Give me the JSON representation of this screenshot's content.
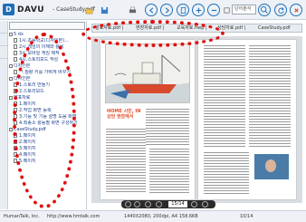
{
  "app": {
    "name": "DAVU",
    "document_title": "CaseStudy.pdf"
  },
  "toolbar": {
    "search_placeholder": "단어분석",
    "buttons": [
      {
        "name": "open-button",
        "icon": "folder-icon"
      },
      {
        "name": "save-button",
        "icon": "save-icon"
      },
      {
        "name": "print-button",
        "icon": "printer-icon"
      },
      {
        "name": "prev-view-button",
        "icon": "left-arrow-icon"
      },
      {
        "name": "next-view-button",
        "icon": "right-arrow-icon"
      },
      {
        "name": "page-view-button",
        "icon": "page-icon"
      },
      {
        "name": "zoom-in-button",
        "icon": "zoom-in-icon"
      },
      {
        "name": "zoom-out-button",
        "icon": "zoom-out-icon"
      },
      {
        "name": "fit-button",
        "icon": "fit-icon"
      },
      {
        "name": "search-button",
        "icon": "search-icon"
      },
      {
        "name": "refresh-button",
        "icon": "refresh-icon"
      },
      {
        "name": "close-button",
        "icon": "close-icon"
      }
    ]
  },
  "sidebar": {
    "tree": [
      {
        "label": "5 dx",
        "depth": 0,
        "kind": "folder"
      },
      {
        "label": "1시.초등학교(디자인본)...",
        "depth": 1,
        "kind": "file"
      },
      {
        "label": "2시.게임의 이해와 활용",
        "depth": 1,
        "kind": "file"
      },
      {
        "label": "3시.모바일 게임 제작",
        "depth": 1,
        "kind": "file"
      },
      {
        "label": "4시.스토리보드 작성",
        "depth": 1,
        "kind": "file"
      },
      {
        "label": "디자인본",
        "depth": 0,
        "kind": "folder"
      },
      {
        "label": "ㄱ.질량 키를 가벼게 바꾸기",
        "depth": 1,
        "kind": "file"
      },
      {
        "label": "디자인본",
        "depth": 0,
        "kind": "folder"
      },
      {
        "label": "1.스토리 만들기",
        "depth": 1,
        "kind": "file"
      },
      {
        "label": "2.스토리보드",
        "depth": 1,
        "kind": "file"
      },
      {
        "label": "발표자료",
        "depth": 0,
        "kind": "folder"
      },
      {
        "label": "1.페이지",
        "depth": 1,
        "kind": "file"
      },
      {
        "label": "2.작업 화면 등록",
        "depth": 1,
        "kind": "file"
      },
      {
        "label": "3.기능 및 기능 설명 도움 화면",
        "depth": 1,
        "kind": "file"
      },
      {
        "label": "4.최종소 활동별 화면 구성하기",
        "depth": 1,
        "kind": "file"
      },
      {
        "label": "CaseStudy.pdf",
        "depth": 0,
        "kind": "folder"
      },
      {
        "label": "1.페이지",
        "depth": 1,
        "kind": "file"
      },
      {
        "label": "2.페이지",
        "depth": 1,
        "kind": "file"
      },
      {
        "label": "3.페이지",
        "depth": 1,
        "kind": "file"
      },
      {
        "label": "4.페이지",
        "depth": 1,
        "kind": "file"
      },
      {
        "label": "5.페이지",
        "depth": 1,
        "kind": "file"
      }
    ]
  },
  "document": {
    "tabs": [
      "발표자료.pdf",
      "현장자료.pdf",
      "교육자료.hwp",
      "상담자료.pdf",
      "CaseStudy.pdf"
    ],
    "headline": "HOME 시민, IN 상담 현장에서",
    "page_indicator": "15/14"
  },
  "status": {
    "company": "HumanTalk, Inc.",
    "url": "http://www.hmtalk.com",
    "page_size": "1440X2080, 200dpi, A4 158.6KB",
    "page_count": "10/14"
  },
  "colors": {
    "accent": "#1f6fb8",
    "annotation": "#e01010",
    "headline": "#e2502a"
  }
}
